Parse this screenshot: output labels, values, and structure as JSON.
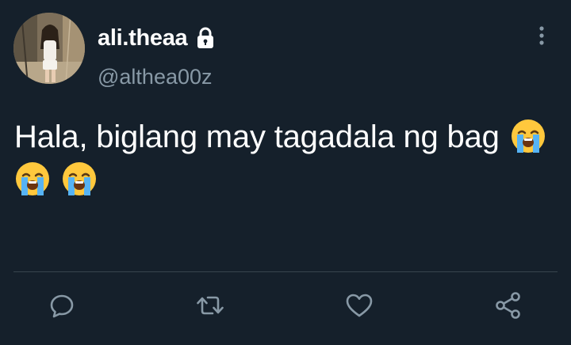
{
  "user": {
    "display_name": "ali.theaa",
    "handle": "@althea00z",
    "protected_icon": "lock-icon",
    "avatar_icon": "profile-photo"
  },
  "tweet": {
    "text": "Hala, biglang may tagadala ng bag",
    "emoji": "loudly-crying-face",
    "emoji_count": 3
  },
  "actions": {
    "reply_icon": "reply-icon",
    "retweet_icon": "retweet-icon",
    "like_icon": "heart-icon",
    "share_icon": "share-icon",
    "more_icon": "more-vertical-icon"
  },
  "colors": {
    "background": "#15202b",
    "primary_text": "#ffffff",
    "secondary_text": "#8899a6",
    "divider": "#38444d"
  }
}
